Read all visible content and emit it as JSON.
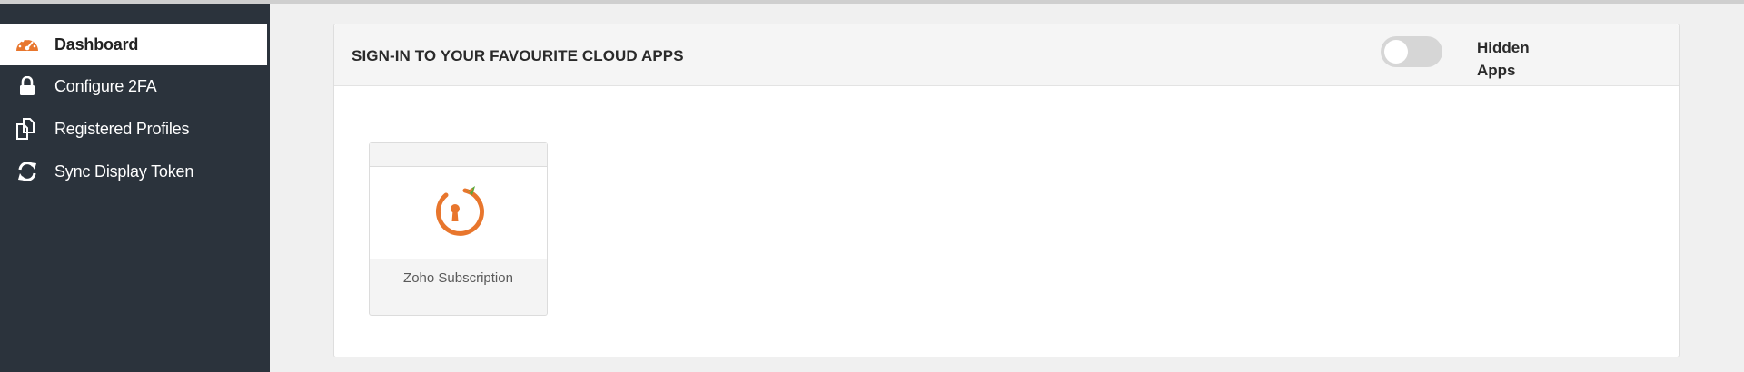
{
  "sidebar": {
    "items": [
      {
        "label": "Dashboard",
        "icon": "dashboard-gauge-icon",
        "active": true
      },
      {
        "label": "Configure 2FA",
        "icon": "lock-icon",
        "active": false
      },
      {
        "label": "Registered Profiles",
        "icon": "copy-documents-icon",
        "active": false
      },
      {
        "label": "Sync Display Token",
        "icon": "sync-refresh-icon",
        "active": false
      }
    ]
  },
  "panel": {
    "title": "SIGN-IN TO YOUR FAVOURITE CLOUD APPS",
    "hidden_apps_label": "Hidden Apps",
    "hidden_apps_toggle": false
  },
  "apps": [
    {
      "name": "Zoho Subscription",
      "icon": "keyhole-logo-icon"
    }
  ],
  "colors": {
    "sidebar_bg": "#2b333c",
    "accent_orange": "#e8762d",
    "leaf_green": "#5aa83a"
  }
}
